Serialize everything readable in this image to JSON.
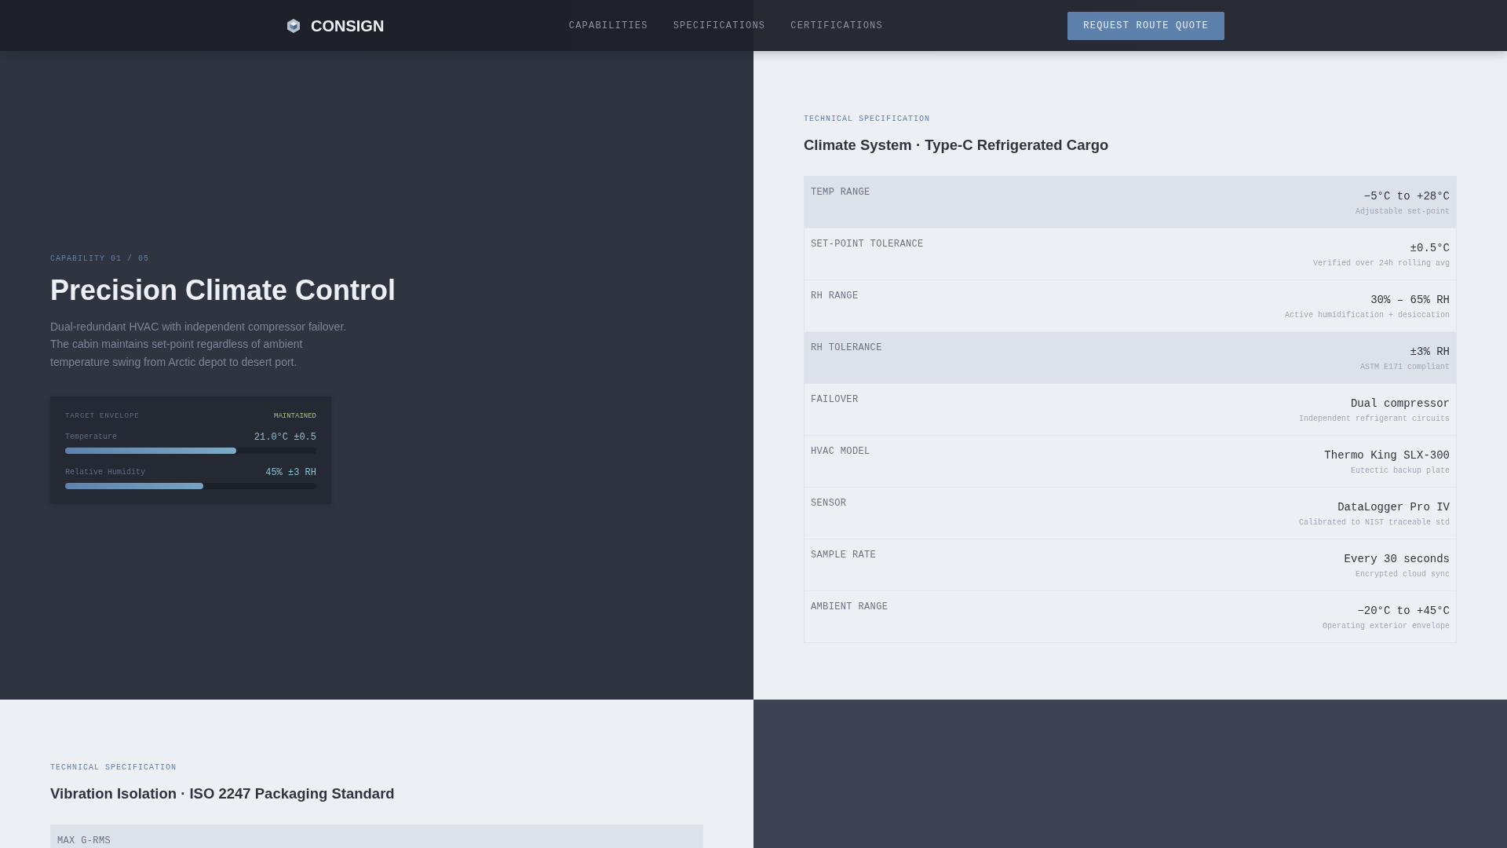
{
  "header": {
    "brand": "CONSIGN",
    "nav": [
      {
        "label": "CAPABILITIES"
      },
      {
        "label": "SPECIFICATIONS"
      },
      {
        "label": "CERTIFICATIONS"
      }
    ],
    "action": "REQUEST ROUTE QUOTE"
  },
  "sections": [
    {
      "panels": [
        {
          "kind": "capability",
          "eyebrow": "CAPABILITY 01 / 05",
          "title": "Precision Climate Control",
          "description": "Dual-redundant HVAC with independent compressor failover. The cabin maintains set-point regardless of ambient temperature swing from Arctic depot to desert port.",
          "envelope": {
            "label": "TARGET ENVELOPE",
            "status": "MAINTAINED",
            "metrics": [
              {
                "name": "Temperature",
                "reading": "21.0°C ±0.5",
                "level": 0.68
              },
              {
                "name": "Relative Humidity",
                "reading": "45% ±3 RH",
                "level": 0.55
              }
            ]
          }
        },
        {
          "kind": "spec",
          "eyebrow": "TECHNICAL SPECIFICATION",
          "title": "Climate System · Type-C Refrigerated Cargo",
          "specs": [
            {
              "label": "TEMP RANGE",
              "value": "−5°C to +28°C",
              "note": "Adjustable set-point",
              "highlighted": true
            },
            {
              "label": "SET-POINT TOLERANCE",
              "value": "±0.5°C",
              "note": "Verified over 24h rolling avg",
              "highlighted": false
            },
            {
              "label": "RH RANGE",
              "value": "30% – 65% RH",
              "note": "Active humidification + desiccation",
              "highlighted": false
            },
            {
              "label": "RH TOLERANCE",
              "value": "±3% RH",
              "note": "ASTM E171 compliant",
              "highlighted": true
            },
            {
              "label": "FAILOVER",
              "value": "Dual compressor",
              "note": "Independent refrigerant circuits",
              "highlighted": false
            },
            {
              "label": "HVAC MODEL",
              "value": "Thermo King SLX-300",
              "note": "Eutectic backup plate",
              "highlighted": false
            },
            {
              "label": "SENSOR",
              "value": "DataLogger Pro IV",
              "note": "Calibrated to NIST traceable std",
              "highlighted": false
            },
            {
              "label": "SAMPLE RATE",
              "value": "Every 30 seconds",
              "note": "Encrypted cloud sync",
              "highlighted": false
            },
            {
              "label": "AMBIENT RANGE",
              "value": "−20°C to +45°C",
              "note": "Operating exterior envelope",
              "highlighted": false
            }
          ]
        }
      ]
    },
    {
      "panels": [
        {
          "kind": "spec",
          "eyebrow": "TECHNICAL SPECIFICATION",
          "title": "Vibration Isolation · ISO 2247 Packaging Standard",
          "specs": [
            {
              "label": "MAX G-RMS",
              "highlighted": true
            }
          ]
        },
        {
          "kind": "capability"
        }
      ]
    }
  ]
}
